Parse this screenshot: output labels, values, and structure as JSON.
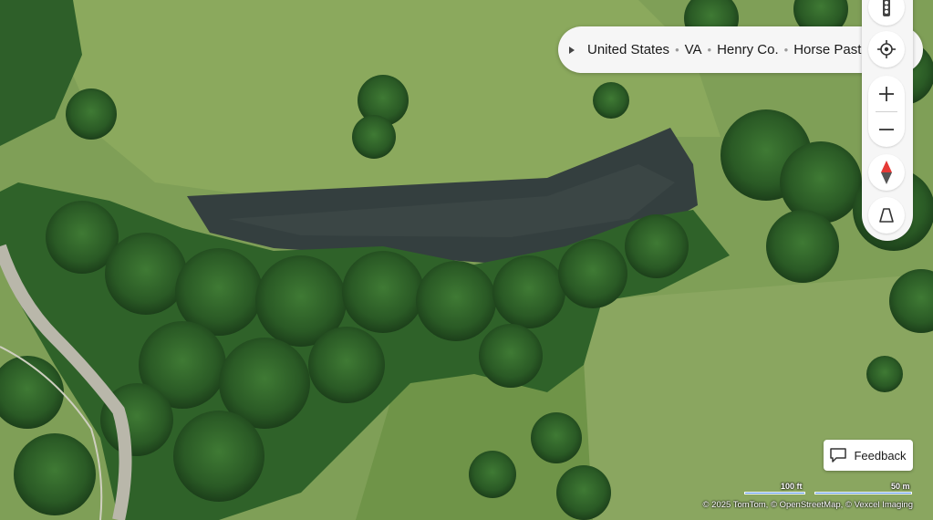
{
  "breadcrumb": {
    "items": [
      "United States",
      "VA",
      "Henry Co.",
      "Horse Pasture"
    ],
    "separator": "•"
  },
  "controls": {
    "traffic_icon": "traffic-light-icon",
    "locate_icon": "locate-me-icon",
    "zoom_in_icon": "plus-icon",
    "zoom_out_icon": "minus-icon",
    "compass_icon": "compass-icon",
    "tilt_icon": "tilt-3d-icon"
  },
  "feedback": {
    "label": "Feedback",
    "icon": "speech-bubble-icon"
  },
  "scale": {
    "imperial": "100 ft",
    "metric": "50 m"
  },
  "attribution": "© 2025 TomTom, © OpenStreetMap, © Vexcel Imaging",
  "colors": {
    "accent": "#e53935",
    "scale": "#4a8de0"
  }
}
